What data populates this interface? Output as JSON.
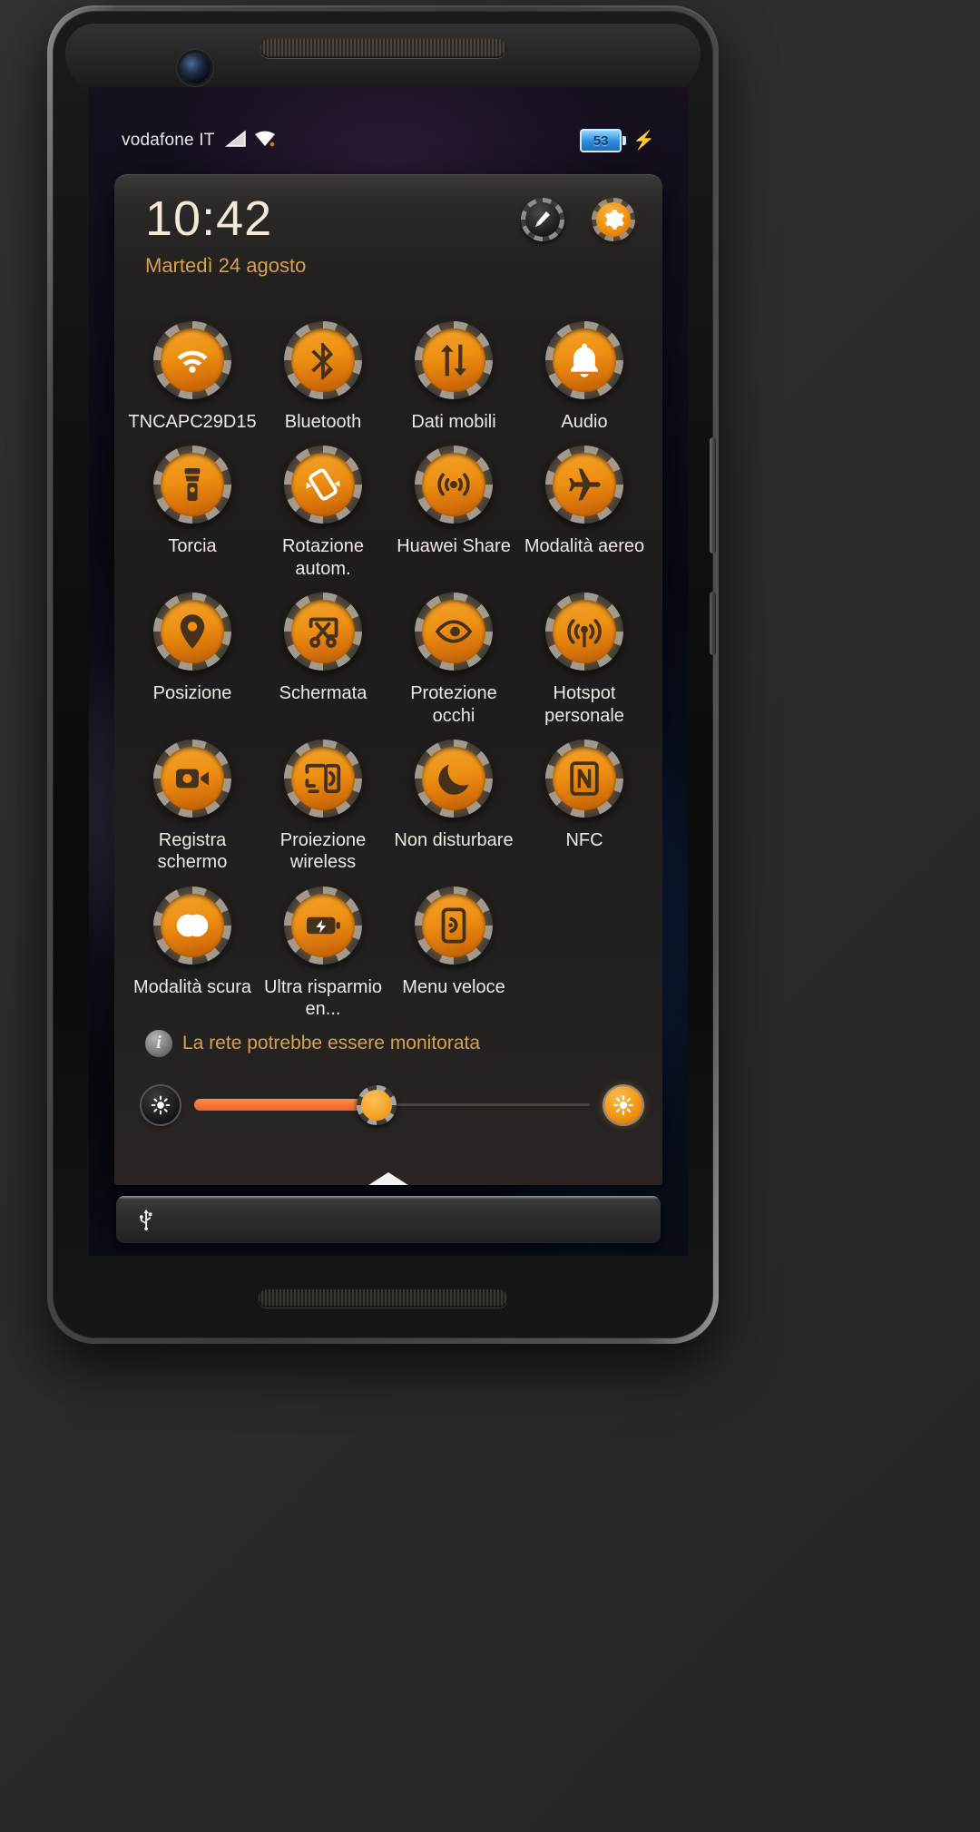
{
  "statusbar": {
    "carrier": "vodafone IT",
    "signal_icon": "cellular-signal-icon",
    "wifi_icon": "wifi-icon",
    "battery_level": "53",
    "battery_icon": "battery-icon",
    "charging_icon": "charging-bolt-icon"
  },
  "panel": {
    "clock": "10:42",
    "date": "Martedì 24 agosto",
    "actions": [
      {
        "name": "edit-toggles-button",
        "icon": "edit-pencil-icon",
        "state": "inactive"
      },
      {
        "name": "settings-button",
        "icon": "gear-icon",
        "state": "active"
      }
    ]
  },
  "tiles": [
    {
      "label": "TNCAPC29D15",
      "icon": "wifi-icon",
      "active": true,
      "icon_tone": "light"
    },
    {
      "label": "Bluetooth",
      "icon": "bluetooth-icon",
      "active": true,
      "icon_tone": "dark"
    },
    {
      "label": "Dati mobili",
      "icon": "mobile-data-icon",
      "active": true,
      "icon_tone": "dark"
    },
    {
      "label": "Audio",
      "icon": "bell-icon",
      "active": true,
      "icon_tone": "light"
    },
    {
      "label": "Torcia",
      "icon": "flashlight-icon",
      "active": true,
      "icon_tone": "dark"
    },
    {
      "label": "Rotazione autom.",
      "icon": "auto-rotate-icon",
      "active": true,
      "icon_tone": "light"
    },
    {
      "label": "Huawei Share",
      "icon": "huawei-share-icon",
      "active": true,
      "icon_tone": "dark"
    },
    {
      "label": "Modalità aereo",
      "icon": "airplane-icon",
      "active": true,
      "icon_tone": "dark"
    },
    {
      "label": "Posizione",
      "icon": "location-pin-icon",
      "active": true,
      "icon_tone": "dark"
    },
    {
      "label": "Schermata",
      "icon": "screenshot-scissors-icon",
      "active": true,
      "icon_tone": "dark"
    },
    {
      "label": "Protezione occhi",
      "icon": "eye-icon",
      "active": true,
      "icon_tone": "dark"
    },
    {
      "label": "Hotspot personale",
      "icon": "hotspot-icon",
      "active": true,
      "icon_tone": "dark"
    },
    {
      "label": "Registra schermo",
      "icon": "screen-record-camera-icon",
      "active": true,
      "icon_tone": "dark"
    },
    {
      "label": "Proiezione wireless",
      "icon": "wireless-projection-icon",
      "active": true,
      "icon_tone": "dark"
    },
    {
      "label": "Non disturbare",
      "icon": "moon-icon",
      "active": true,
      "icon_tone": "dark"
    },
    {
      "label": "NFC",
      "icon": "nfc-icon",
      "active": true,
      "icon_tone": "dark"
    },
    {
      "label": "Modalità scura",
      "icon": "dark-mode-icon",
      "active": true,
      "icon_tone": "light"
    },
    {
      "label": "Ultra risparmio en...",
      "icon": "battery-saver-icon",
      "active": true,
      "icon_tone": "dark"
    },
    {
      "label": "Menu veloce",
      "icon": "quick-menu-icon",
      "active": true,
      "icon_tone": "dark"
    }
  ],
  "warning": {
    "icon": "info-icon",
    "text": "La rete potrebbe essere monitorata"
  },
  "brightness": {
    "low_icon": "brightness-low-icon",
    "high_icon": "brightness-high-icon",
    "value_percent": 46,
    "expand_handle_icon": "chevron-up-handle-icon"
  },
  "notification_bar": {
    "icon": "usb-icon"
  },
  "colors": {
    "accent_orange": "#ed8f12",
    "gold_text": "#d9a14a",
    "clock_text": "#f5e8d6",
    "slider_fill": "#f1622b",
    "battery_blue": "#2e8fe0"
  },
  "device": {
    "earpiece": "earpiece-grille",
    "camera": "front-camera",
    "speaker": "bottom-speaker-grille"
  }
}
